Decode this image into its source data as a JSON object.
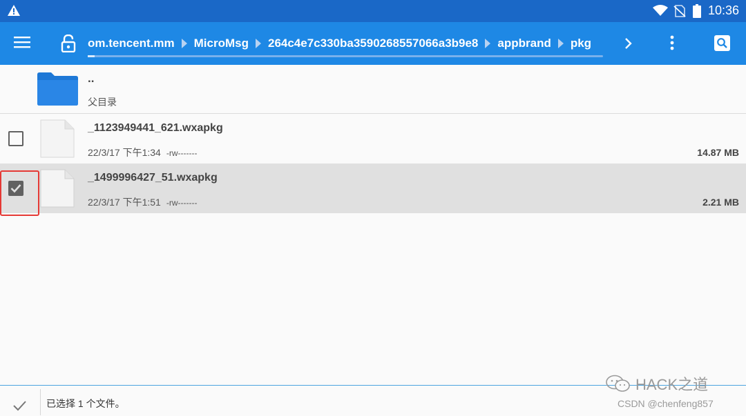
{
  "status_bar": {
    "time": "10:36",
    "icons": [
      "warning-icon",
      "wifi-icon",
      "no-sim-icon",
      "battery-icon"
    ]
  },
  "toolbar": {
    "breadcrumbs": [
      "om.tencent.mm",
      "MicroMsg",
      "264c4e7c330ba3590268557066a3b9e8",
      "appbrand",
      "pkg"
    ],
    "icons": [
      "menu-icon",
      "lock-icon",
      "chevron-right-icon",
      "more-vert-icon",
      "search-icon"
    ],
    "progress": 0.013
  },
  "parent_entry": {
    "name": "..",
    "label": "父目录"
  },
  "files": [
    {
      "name": "_1123949441_621.wxapkg",
      "date": "22/3/17 下午1:34",
      "permissions": "-rw-------",
      "size": "14.87 MB",
      "checked": false
    },
    {
      "name": "_1499996427_51.wxapkg",
      "date": "22/3/17 下午1:51",
      "permissions": "-rw-------",
      "size": "2.21 MB",
      "checked": true
    }
  ],
  "bottom_bar": {
    "status_text": "已选择 1 个文件。"
  },
  "watermark": {
    "text": "HACK之道",
    "credit": "CSDN @chenfeng857"
  },
  "colors": {
    "status_bar": "#1a68c7",
    "toolbar": "#1e88e5",
    "selected_row": "#e0e0e0",
    "highlight_box": "#e53935",
    "folder": "#1e78d6"
  }
}
